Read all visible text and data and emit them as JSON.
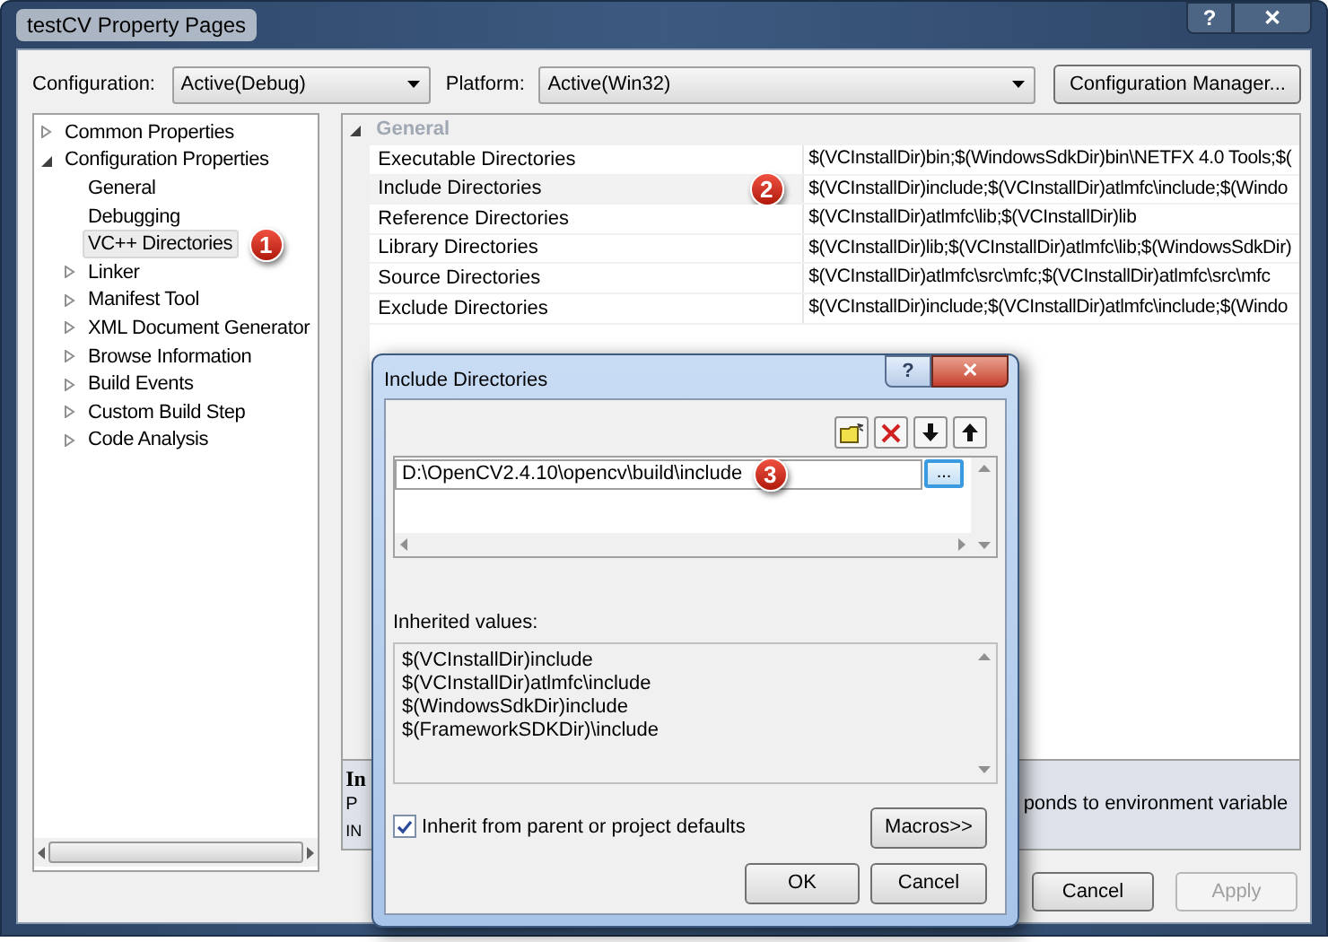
{
  "window": {
    "title": "testCV Property Pages",
    "help_button": "?",
    "close_button": "✕"
  },
  "configuration": {
    "label": "Configuration:",
    "value": "Active(Debug)"
  },
  "platform": {
    "label": "Platform:",
    "value": "Active(Win32)"
  },
  "configuration_manager_button": "Configuration Manager...",
  "tree": [
    {
      "label": "Common Properties",
      "kind": "group",
      "expanded": false,
      "selected": false
    },
    {
      "label": "Configuration Properties",
      "kind": "group",
      "expanded": true,
      "selected": false,
      "children": [
        {
          "label": "General",
          "kind": "leaf",
          "selected": false
        },
        {
          "label": "Debugging",
          "kind": "leaf",
          "selected": false
        },
        {
          "label": "VC++ Directories",
          "kind": "leaf",
          "selected": true,
          "callout": "1"
        },
        {
          "label": "Linker",
          "kind": "group",
          "expanded": false,
          "selected": false
        },
        {
          "label": "Manifest Tool",
          "kind": "group",
          "expanded": false,
          "selected": false
        },
        {
          "label": "XML Document Generator",
          "kind": "group",
          "expanded": false,
          "selected": false
        },
        {
          "label": "Browse Information",
          "kind": "group",
          "expanded": false,
          "selected": false
        },
        {
          "label": "Build Events",
          "kind": "group",
          "expanded": false,
          "selected": false
        },
        {
          "label": "Custom Build Step",
          "kind": "group",
          "expanded": false,
          "selected": false
        },
        {
          "label": "Code Analysis",
          "kind": "group",
          "expanded": false,
          "selected": false
        }
      ]
    }
  ],
  "grid": {
    "category": "General",
    "expanded": true,
    "rows": [
      {
        "name": "Executable Directories",
        "value": "$(VCInstallDir)bin;$(WindowsSdkDir)bin\\NETFX 4.0 Tools;$(",
        "selected": false
      },
      {
        "name": "Include Directories",
        "value": "$(VCInstallDir)include;$(VCInstallDir)atlmfc\\include;$(Windo",
        "selected": true,
        "callout": "2"
      },
      {
        "name": "Reference Directories",
        "value": "$(VCInstallDir)atlmfc\\lib;$(VCInstallDir)lib",
        "selected": false
      },
      {
        "name": "Library Directories",
        "value": "$(VCInstallDir)lib;$(VCInstallDir)atlmfc\\lib;$(WindowsSdkDir)",
        "selected": false
      },
      {
        "name": "Source Directories",
        "value": "$(VCInstallDir)atlmfc\\src\\mfc;$(VCInstallDir)atlmfc\\src\\mfc",
        "selected": false
      },
      {
        "name": "Exclude Directories",
        "value": "$(VCInstallDir)include;$(VCInstallDir)atlmfc\\include;$(Windo",
        "selected": false
      }
    ]
  },
  "description": {
    "title": "In",
    "lines": [
      "P",
      "IN"
    ],
    "fragment": "ponds to environment variable"
  },
  "buttons": [
    {
      "label": "Cancel",
      "disabled": false
    },
    {
      "label": "Apply",
      "disabled": true
    }
  ],
  "dialog": {
    "title": "Include Directories",
    "help_button": "?",
    "close_button": "✕",
    "entries": [
      {
        "value": "D:\\OpenCV2.4.10\\opencv\\build\\include",
        "browse_button": "...",
        "callout": "3"
      }
    ],
    "inherited_label": "Inherited values:",
    "inherited_values": [
      "$(VCInstallDir)include",
      "$(VCInstallDir)atlmfc\\include",
      "$(WindowsSdkDir)include",
      "$(FrameworkSDKDir)\\include"
    ],
    "inherit_checkbox": {
      "label": "Inherit from parent or project defaults",
      "checked": true
    },
    "macros_button": "Macros>>",
    "ok_button": "OK",
    "cancel_button": "Cancel"
  }
}
